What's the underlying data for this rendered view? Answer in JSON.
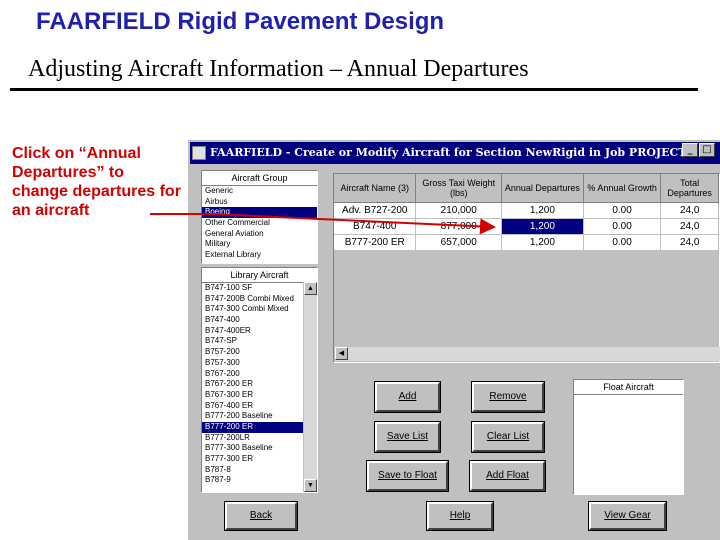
{
  "slide": {
    "title": "FAARFIELD Rigid Pavement Design",
    "subtitle": "Adjusting Aircraft Information – Annual Departures",
    "callout": "Click on “Annual Departures” to change departures for an aircraft"
  },
  "window": {
    "title": "FAARFIELD - Create or Modify Aircraft for Section NewRigid in Job PROJECT",
    "minimize": "_",
    "maximize": "□",
    "close": "×"
  },
  "aircraft_group": {
    "header": "Aircraft Group",
    "items": [
      "Generic",
      "Airbus",
      "Boeing",
      "Other Commercial",
      "General Aviation",
      "Military",
      "External Library"
    ],
    "selected_index": 2
  },
  "library_aircraft": {
    "header": "Library Aircraft",
    "items": [
      "B747-100 SF",
      "B747-200B Combi Mixed",
      "B747-300 Combi Mixed",
      "B747-400",
      "B747-400ER",
      "B747-SP",
      "B757-200",
      "B757-300",
      "B767-200",
      "B767-200 ER",
      "B767-300 ER",
      "B767-400 ER",
      "B777-200 Baseline",
      "B777-200 ER",
      "B777-200LR",
      "B777-300 Baseline",
      "B777-300 ER",
      "B787-8",
      "B787-9"
    ],
    "selected_index": 13
  },
  "grid": {
    "headers": [
      "Aircraft Name (3)",
      "Gross Taxi Weight (lbs)",
      "Annual Departures",
      "% Annual Growth",
      "Total Departures"
    ],
    "rows": [
      [
        "Adv. B727-200",
        "210,000",
        "1,200",
        "0.00",
        "24,0"
      ],
      [
        "B747-400",
        "877,000",
        "1,200",
        "0.00",
        "24,0"
      ],
      [
        "B777-200 ER",
        "657,000",
        "1,200",
        "0.00",
        "24,0"
      ]
    ],
    "highlight": {
      "row": 1,
      "col": 2
    }
  },
  "buttons": {
    "add": "Add",
    "remove": "Remove",
    "save_list": "Save List",
    "clear_list": "Clear List",
    "save_to_float": "Save to Float",
    "add_float": "Add Float",
    "back": "Back",
    "help": "Help",
    "view_gear": "View Gear"
  },
  "float_aircraft": {
    "header": "Float Aircraft"
  },
  "colors": {
    "title_blue": "#1f1fb0",
    "callout_red": "#d40000",
    "selection": "#000080",
    "window_face": "#c0c0c0"
  }
}
